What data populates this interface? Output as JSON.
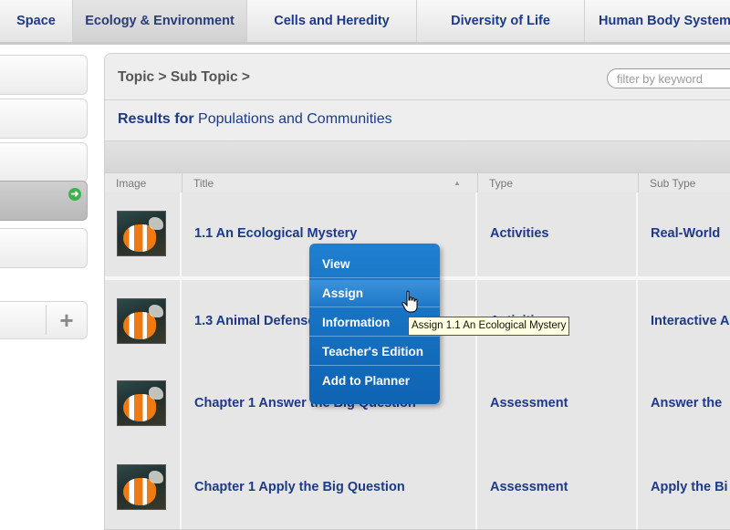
{
  "tabs": [
    {
      "label": "Space",
      "active": false
    },
    {
      "label": "Ecology & Environment",
      "active": true
    },
    {
      "label": "Cells and Heredity",
      "active": false
    },
    {
      "label": "Diversity of Life",
      "active": false
    },
    {
      "label": "Human Body Systems",
      "active": false
    }
  ],
  "sidebar": {
    "selected_icon": "arrow-right-circle-icon",
    "add_icon": "plus-icon",
    "accent_color": "#3cb34a"
  },
  "breadcrumb": "Topic > Sub Topic >",
  "search": {
    "placeholder": "filter by keyword",
    "value": ""
  },
  "results": {
    "lead": "Results for",
    "topic": "Populations and Communities"
  },
  "table": {
    "columns": [
      "Image",
      "Title",
      "Type",
      "Sub Type"
    ],
    "sort_icon": "sort-ascending-icon",
    "rows": [
      {
        "thumbnail_icon": "clownfish-icon",
        "title": "1.1 An Ecological Mystery",
        "type": "Activities",
        "sub_type": "Real-World"
      },
      {
        "thumbnail_icon": "clownfish-icon",
        "title": "1.3 Animal Defenses",
        "type": "Activities",
        "sub_type": "Interactive A"
      },
      {
        "thumbnail_icon": "clownfish-icon",
        "title": "Chapter 1 Answer the Big Question",
        "type": "Assessment",
        "sub_type": "Answer the"
      },
      {
        "thumbnail_icon": "clownfish-icon",
        "title": "Chapter 1 Apply the Big Question",
        "type": "Assessment",
        "sub_type": "Apply the Bi"
      }
    ]
  },
  "context_menu": {
    "items": [
      "View",
      "Assign",
      "Information",
      "Teacher's Edition",
      "Add to Planner"
    ],
    "highlighted": "Assign",
    "color": "#1f7fd0"
  },
  "cursor_icon": "hand-pointer-icon",
  "tooltip": "Assign 1.1 An Ecological Mystery"
}
